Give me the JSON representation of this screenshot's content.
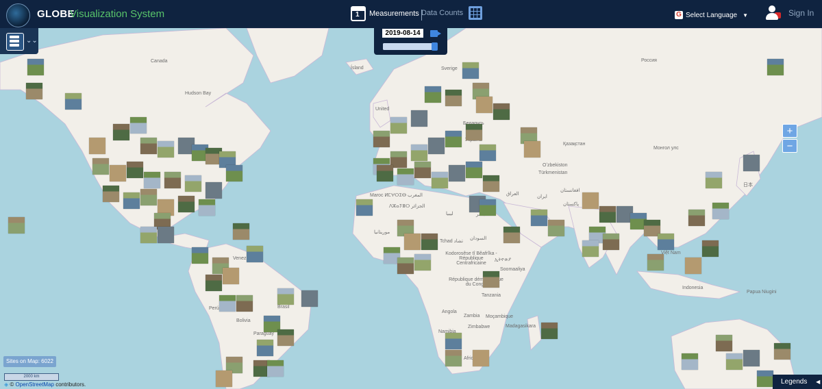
{
  "header": {
    "logo_text": "GLOBE",
    "logo_sub": "Visualization System",
    "measurements_label": "Measurements",
    "measurements_icon_number": "1",
    "data_counts_label": "Data Counts",
    "language_label": "Select Language",
    "signin_label": "Sign In"
  },
  "timeline": {
    "date": "2019-08-14",
    "slider_position": 1.0
  },
  "map_labels": [
    "Canada",
    "Hudson Bay",
    "Ísland",
    "Sverige",
    "Россия",
    "United",
    "Беларусь",
    "Україна",
    "Қазақстан",
    "Монгол улс",
    "Oʻzbekiston",
    "Türkmenistan",
    "افغانستان",
    "ایران",
    "العراق",
    "پاکستان",
    "日本",
    "Maroc ⵍⵎⵖⵔⵉⴱ المغرب",
    "ⴷⵣⴰⵢⴻⵔ الجزائر",
    "ليبيا",
    "مصر",
    "موريتانيا",
    "Tchad تشاد",
    "السودان",
    "Kodorosêse tî Bêafrîka - République Centrafricaine",
    "ኢትዮጵያ",
    "Soomaaliya",
    "République démocratique du Congo",
    "Tanzania",
    "Angola",
    "Zambia",
    "Moçambique",
    "Namibia",
    "Zimbabwe",
    "Madagasikara",
    "Africa",
    "Venez",
    "Brasil",
    "Perú",
    "Bolivia",
    "Paraguay",
    "Việt Nam",
    "Indonesia",
    "Papua Niugini"
  ],
  "zoom": {
    "in": "+",
    "out": "−"
  },
  "footer": {
    "sites_count": "Sites on Map: 6022",
    "scale": "2000 km",
    "attribution_prefix": "© ",
    "attribution_link": "OpenStreetMap",
    "attribution_suffix": " contributors.",
    "legends_label": "Legends",
    "legends_arrow": "◀"
  },
  "colors": {
    "header_bg": "#0f2340",
    "accent_green": "#58c46a",
    "ocean": "#aad3df",
    "land": "#f2efe9",
    "button_blue": "#6fa6e4"
  }
}
